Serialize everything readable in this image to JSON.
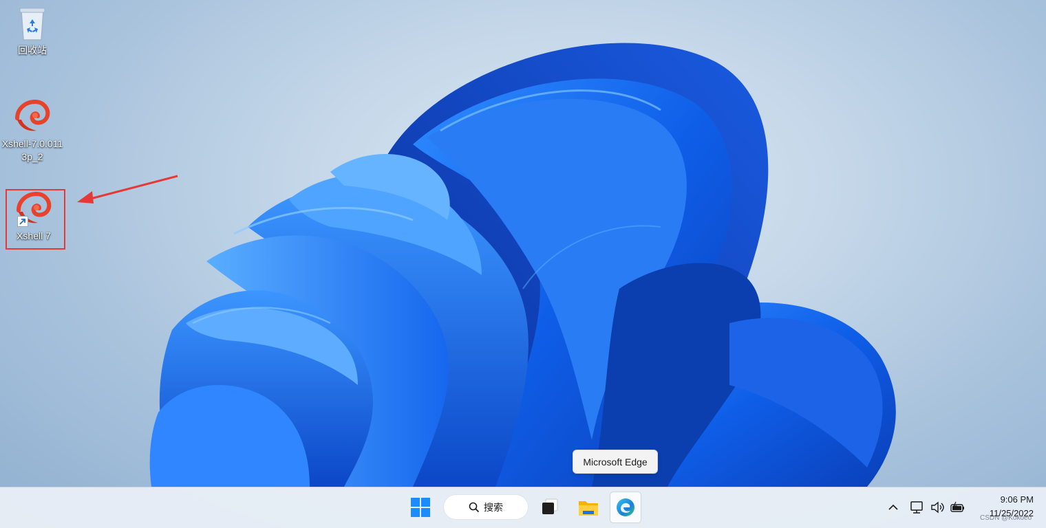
{
  "desktop": {
    "icons": [
      {
        "label": "回收站",
        "icon": "recycle-bin-icon"
      },
      {
        "label": "Xshell-7.0.0113p_2",
        "icon": "xshell-icon"
      },
      {
        "label": "Xshell 7",
        "icon": "xshell-icon",
        "shortcut": true,
        "highlighted": true
      }
    ],
    "annotation": {
      "highlight_color": "#e53935",
      "arrow_color": "#e53935"
    }
  },
  "tooltip": {
    "text": "Microsoft Edge"
  },
  "taskbar": {
    "items": [
      {
        "name": "start-button",
        "icon": "windows-start-icon"
      },
      {
        "name": "search",
        "label": "搜索",
        "icon": "search-icon"
      },
      {
        "name": "task-view",
        "icon": "task-view-icon"
      },
      {
        "name": "file-explorer",
        "icon": "folder-icon"
      },
      {
        "name": "edge",
        "icon": "edge-icon",
        "active": true
      }
    ],
    "tray": {
      "icons": [
        "chevron-up-icon",
        "network-icon",
        "volume-icon",
        "battery-icon"
      ],
      "time": "9:06 PM",
      "date": "11/25/2022"
    }
  },
  "watermark": "CSDN @Kokoeo",
  "colors": {
    "accent": "#1a73e8",
    "taskbar_bg": "#e8eef6"
  }
}
